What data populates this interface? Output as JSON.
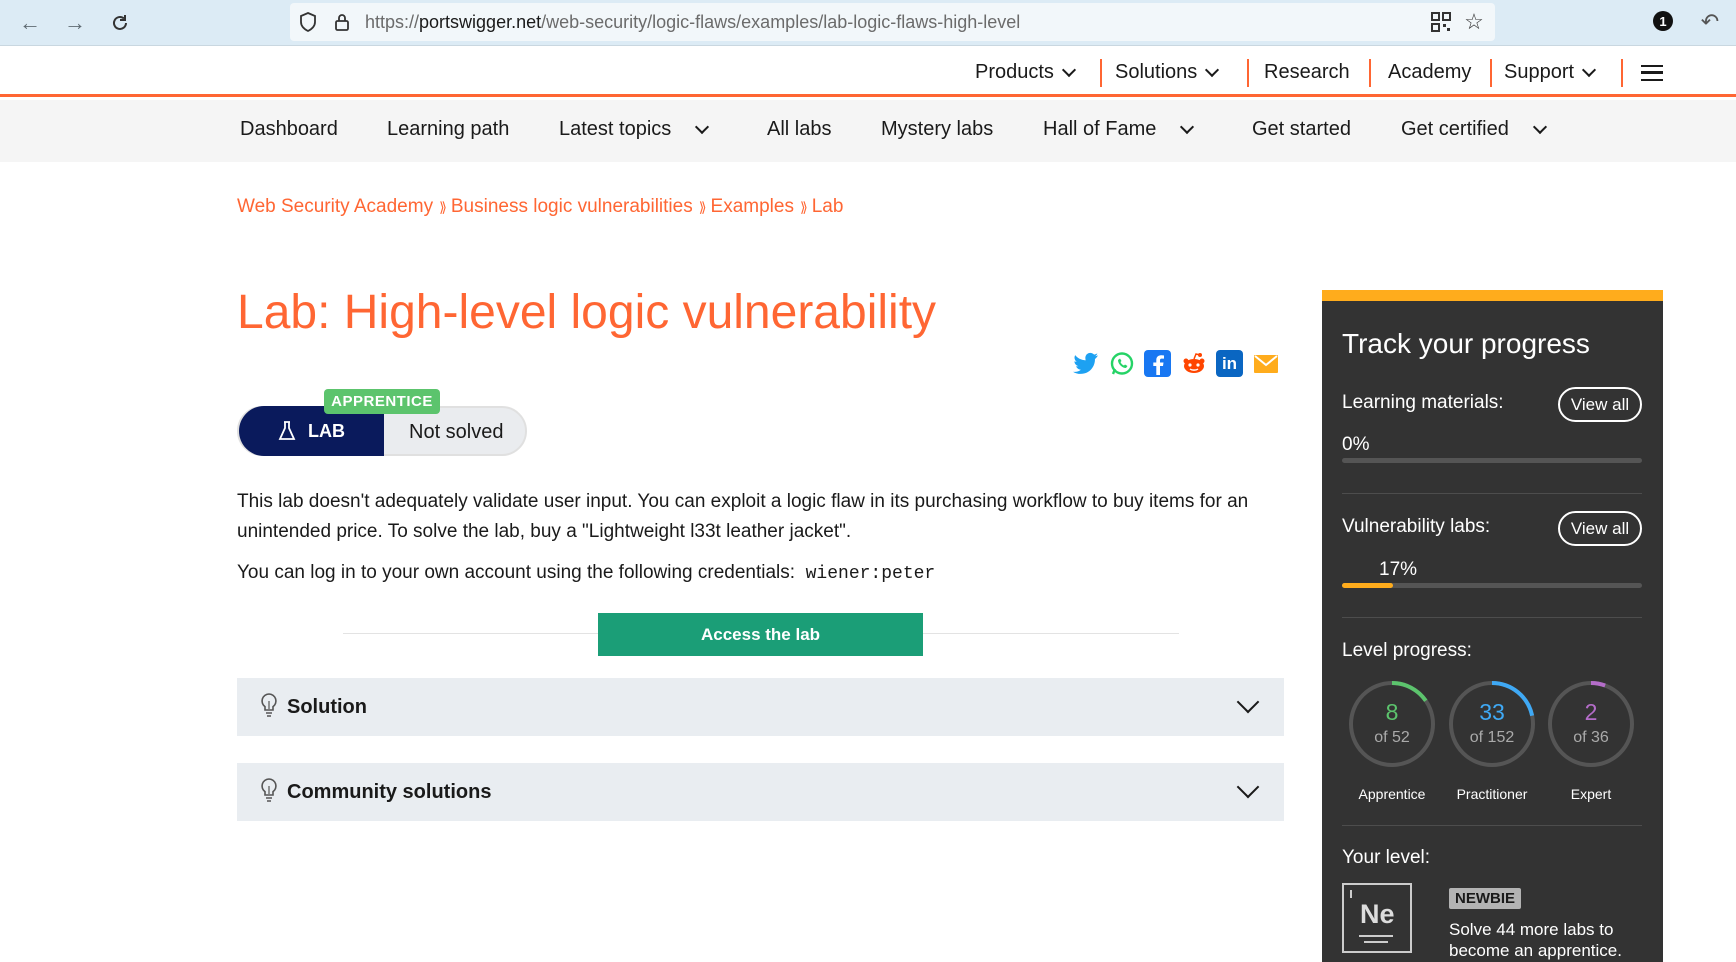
{
  "browser": {
    "url_prefix": "https://",
    "url_host": "portswigger.net",
    "url_path": "/web-security/logic-flaws/examples/lab-logic-flaws-high-level",
    "notification_count": "1"
  },
  "topnav": {
    "items": [
      "Products",
      "Solutions",
      "Research",
      "Academy",
      "Support"
    ]
  },
  "subnav": {
    "items": [
      "Dashboard",
      "Learning path",
      "Latest topics",
      "All labs",
      "Mystery labs",
      "Hall of Fame",
      "Get started",
      "Get certified"
    ]
  },
  "breadcrumb": [
    "Web Security Academy",
    "Business logic vulnerabilities",
    "Examples",
    "Lab"
  ],
  "breadcrumb_sep": "⟫",
  "main": {
    "title": "Lab: High-level logic vulnerability",
    "level_tag": "APPRENTICE",
    "lab_label": "LAB",
    "status": "Not solved",
    "description": "This lab doesn't adequately validate user input. You can exploit a logic flaw in its purchasing workflow to buy items for an unintended price. To solve the lab, buy a \"Lightweight l33t leather jacket\".",
    "credentials_text": "You can log in to your own account using the following credentials:",
    "credentials": "wiener:peter",
    "access_button": "Access the lab",
    "accordions": [
      "Solution",
      "Community solutions"
    ]
  },
  "share_icons": [
    "twitter-icon",
    "whatsapp-icon",
    "facebook-icon",
    "reddit-icon",
    "linkedin-icon",
    "email-icon"
  ],
  "progress": {
    "title": "Track your progress",
    "learning_label": "Learning materials:",
    "learning_pct": "0%",
    "learning_fraction": 0.0,
    "vuln_label": "Vulnerability labs:",
    "vuln_pct": "17%",
    "vuln_fraction": 0.17,
    "view_all": "View all",
    "level_label": "Level progress:",
    "rings": [
      {
        "num": "8",
        "sub": "of 52",
        "label": "Apprentice",
        "color": "#5cc46d",
        "fraction": 0.154
      },
      {
        "num": "33",
        "sub": "of 152",
        "label": "Practitioner",
        "color": "#3fa9f5",
        "fraction": 0.217
      },
      {
        "num": "2",
        "sub": "of 36",
        "label": "Expert",
        "color": "#b46dc9",
        "fraction": 0.056
      }
    ],
    "your_level_label": "Your level:",
    "level_symbol": "Ne",
    "level_name": "NEWBIE",
    "level_desc": "Solve 44 more labs to become an apprentice."
  },
  "colors": {
    "accent": "#ff6633",
    "lab_dark": "#0a1a5c",
    "access_green": "#1b9e77",
    "progress_orange": "#ffac1c"
  }
}
